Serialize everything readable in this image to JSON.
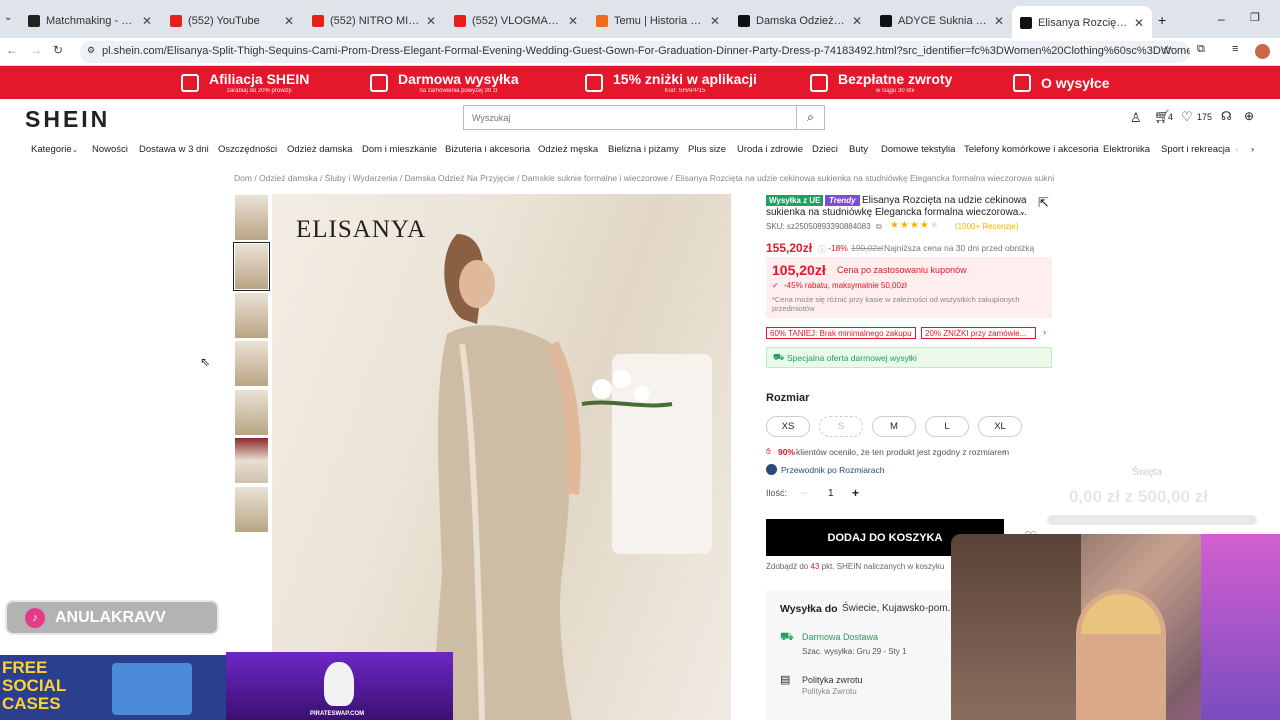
{
  "browser": {
    "tabs": [
      {
        "title": "Matchmaking - Europe 5...",
        "color": "#222222"
      },
      {
        "title": "(552) YouTube",
        "color": "#e62117"
      },
      {
        "title": "(552) NITRO MIAŻDŻY Ma...",
        "color": "#e62117"
      },
      {
        "title": "(552) VLOGMAS 5: PRZYG...",
        "color": "#e62117"
      },
      {
        "title": "Temu | Historia przegląda...",
        "color": "#f06a1c"
      },
      {
        "title": "Damska Odzież Na Przyję...",
        "color": "#111111"
      },
      {
        "title": "ADYCE Suknia wieczorow...",
        "color": "#111111"
      },
      {
        "title": "Elisanya Rozcięta na udzie...",
        "color": "#111111"
      }
    ],
    "url": "pl.shein.com/Elisanya-Split-Thigh-Sequins-Cami-Prom-Dress-Elegant-Formal-Evening-Wedding-Guest-Gown-For-Graduation-Dinner-Party-Dress-p-74183492.html?src_identifier=fc%3DWomen%20Clothing%60sc%3DWomen%20Clothing%60tc%3DS..."
  },
  "promo": [
    {
      "title": "Afiliacja SHEIN",
      "sub": "zarabiaj do 20% prowizji"
    },
    {
      "title": "Darmowa wysyłka",
      "sub": "na zamówienia powyżej 39 zł"
    },
    {
      "title": "15% zniżki w aplikacji",
      "sub": "Kod: SHAPP15"
    },
    {
      "title": "Bezpłatne zwroty",
      "sub": "w ciągu 30 dni"
    },
    {
      "title": "O wysyłce",
      "sub": ""
    }
  ],
  "header": {
    "logo": "SHEIN",
    "search_placeholder": "Wyszukaj",
    "cart_count": "4",
    "wishlist_count": "175"
  },
  "nav": [
    "Kategorie",
    "Nowości",
    "Dostawa w 3 dni",
    "Oszczędności",
    "Odzież damska",
    "Dom i mieszkanie",
    "Biżuteria i akcesoria",
    "Odzież męska",
    "Bielizna i piżamy",
    "Plus size",
    "Uroda i zdrowie",
    "Dzieci",
    "Buty",
    "Domowe tekstylia",
    "Telefony komórkowe i akcesoria",
    "Elektronika",
    "Sport i rekreacja"
  ],
  "breadcrumb": [
    "Dom",
    "Odzież damska",
    "Śluby i Wydarzenia",
    "Damska Odzież Na Przyjęcie",
    "Damskie suknie formalne i wieczorowe",
    "Elisanya Rozcięta na udzie cekinowa sukienka na studniówkę Elegancka formalna wieczorowa suknia d..."
  ],
  "product": {
    "badge_eu": "Wysyłka z UE",
    "badge_trendy": "Trendy",
    "title": "Elisanya Rozcięta na udzie cekinowa sukienka na studniówkę Elegancka formalna wieczorowa...",
    "sku": "SKU: sz25050893390884083",
    "reviews": "(1000+ Recenzje)",
    "rating": 4.5,
    "price": "155,20zł",
    "discount": "-18%",
    "old_price": "190,02zł",
    "lowest_note": "Najniższa cena na 30 dni przed obniżką",
    "coupon_price": "105,20zł",
    "coupon_label": "Cena po zastosowaniu kuponów",
    "coupon_detail": "-45% rabatu, maksymalnie 50,00zł",
    "coupon_note": "*Cena może się różnić przy kasie w zależności od wszystkich zakupionych przedmiotów",
    "promo1": "60% TANIEJ: Brak minimalnego zakupu",
    "promo2": "20% ZNIŻKI przy zamówie...",
    "shipping_offer": "Specjalna oferta darmowej wysyłki",
    "size_label": "Rozmiar",
    "sizes": [
      "XS",
      "S",
      "M",
      "L",
      "XL"
    ],
    "fit_note_pct": "90%",
    "fit_note": "klientów oceniło, że ten produkt jest zgodny z rozmiarem",
    "size_guide": "Przewodnik po Rozmiarach",
    "qty_label": "Ilość:",
    "qty": "1",
    "add_to_cart": "DODAJ DO KOSZYKA",
    "points_pre": "Zdobądź do",
    "points_num": "43",
    "points_post": "pkt. SHEIN naliczanych w koszyku",
    "ship_to_label": "Wysyłka do",
    "ship_to": "Świecie, Kujawsko-pom...",
    "free_delivery": "Darmowa Dostawa",
    "est_delivery": "Szac. wysyłka: Gru 29 - Sty 1",
    "return_policy": "Polityka zwrotu",
    "return_sub": "Polityka Zwrotu"
  },
  "image_brand": "ELISANYA",
  "overlay": {
    "goal_title": "Święta",
    "goal_value": "0,00 zł z 500,00 zł",
    "tiktok": "ANULAKRAVV",
    "ad_text": "FREE SOCIAL CASES",
    "ad2_text": "PIRATESWAP.COM"
  }
}
